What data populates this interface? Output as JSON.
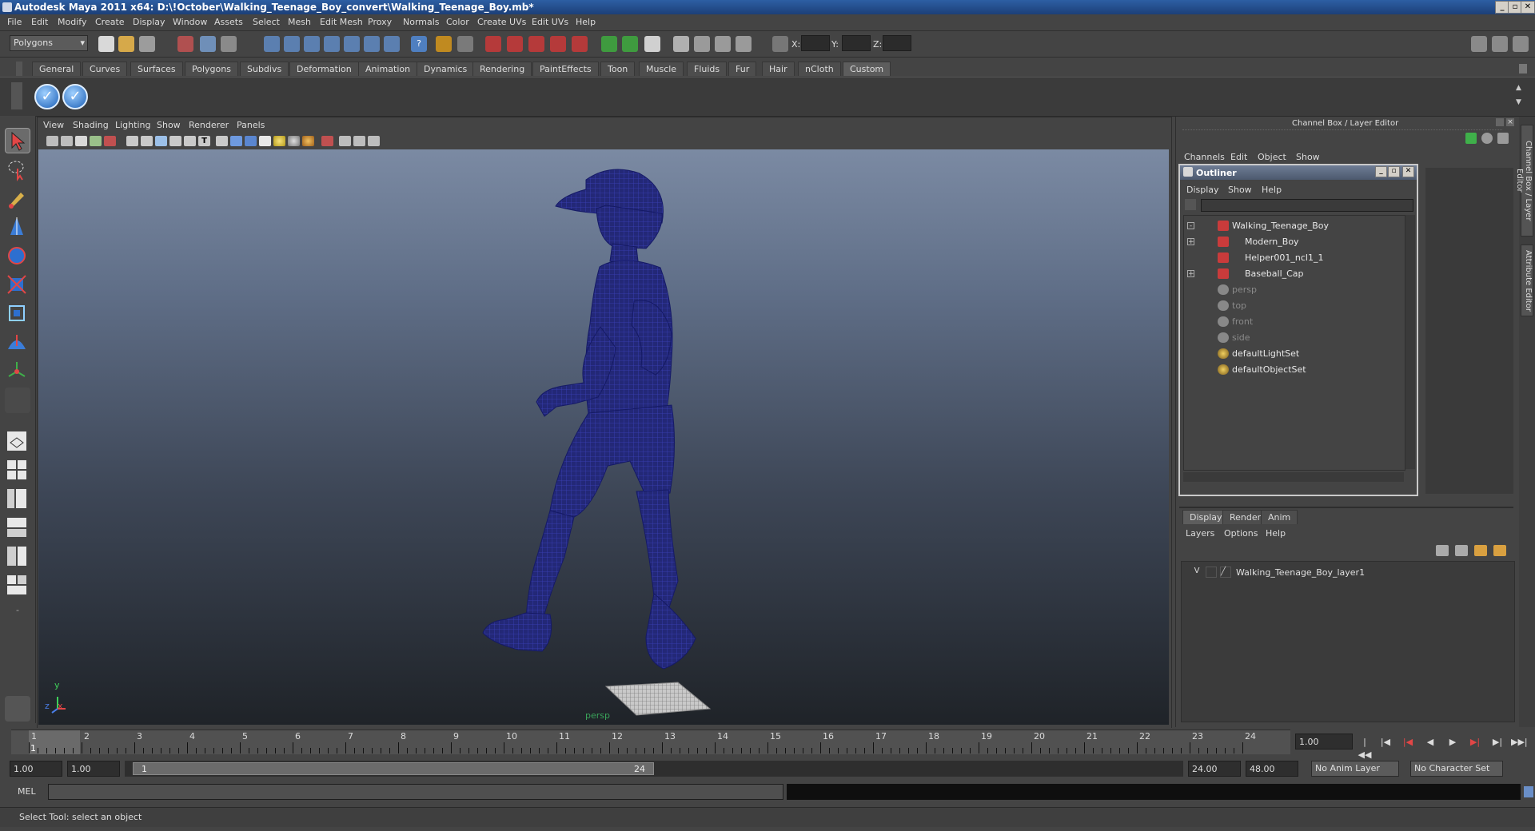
{
  "window": {
    "title": "Autodesk Maya 2011 x64: D:\\!October\\Walking_Teenage_Boy_convert\\Walking_Teenage_Boy.mb*"
  },
  "menubar": [
    "File",
    "Edit",
    "Modify",
    "Create",
    "Display",
    "Window",
    "Assets",
    "Select",
    "Mesh",
    "Edit Mesh",
    "Proxy",
    "Normals",
    "Color",
    "Create UVs",
    "Edit UVs",
    "Help"
  ],
  "statusline": {
    "mode": "Polygons",
    "x_label": "X:",
    "y_label": "Y:",
    "z_label": "Z:"
  },
  "shelf": {
    "tabs": [
      "General",
      "Curves",
      "Surfaces",
      "Polygons",
      "Subdivs",
      "Deformation",
      "Animation",
      "Dynamics",
      "Rendering",
      "PaintEffects",
      "Toon",
      "Muscle",
      "Fluids",
      "Fur",
      "Hair",
      "nCloth",
      "Custom"
    ],
    "active_tab": "Custom"
  },
  "viewport": {
    "menu": [
      "View",
      "Shading",
      "Lighting",
      "Show",
      "Renderer",
      "Panels"
    ],
    "camera_label": "persp",
    "axis_y": "y",
    "axis_x": "x",
    "axis_z": "z",
    "wireframe_color": "#1a1f7a"
  },
  "channelbox": {
    "header": "Channel Box / Layer Editor",
    "menu": [
      "Channels",
      "Edit",
      "Object",
      "Show"
    ]
  },
  "outliner": {
    "title": "Outliner",
    "menu": [
      "Display",
      "Show",
      "Help"
    ],
    "items": [
      {
        "label": "Walking_Teenage_Boy",
        "icon": "transform-icon",
        "expander": "-",
        "dimmed": false
      },
      {
        "label": "Modern_Boy",
        "icon": "transform-icon",
        "expander": "+",
        "dimmed": false
      },
      {
        "label": "Helper001_ncl1_1",
        "icon": "transform-icon",
        "expander": "",
        "dimmed": false
      },
      {
        "label": "Baseball_Cap",
        "icon": "transform-icon",
        "expander": "+",
        "dimmed": false
      },
      {
        "label": "persp",
        "icon": "camera-icon",
        "expander": "",
        "dimmed": true
      },
      {
        "label": "top",
        "icon": "camera-icon",
        "expander": "",
        "dimmed": true
      },
      {
        "label": "front",
        "icon": "camera-icon",
        "expander": "",
        "dimmed": true
      },
      {
        "label": "side",
        "icon": "camera-icon",
        "expander": "",
        "dimmed": true
      },
      {
        "label": "defaultLightSet",
        "icon": "set-icon",
        "expander": "",
        "dimmed": false
      },
      {
        "label": "defaultObjectSet",
        "icon": "set-icon",
        "expander": "",
        "dimmed": false
      }
    ]
  },
  "layers": {
    "tabs": [
      "Display",
      "Render",
      "Anim"
    ],
    "active_tab": "Display",
    "menu": [
      "Layers",
      "Options",
      "Help"
    ],
    "rows": [
      {
        "visible": "V",
        "name": "Walking_Teenage_Boy_layer1"
      }
    ]
  },
  "timeline": {
    "ticks": [
      "1",
      "2",
      "3",
      "4",
      "5",
      "6",
      "7",
      "8",
      "9",
      "10",
      "11",
      "12",
      "13",
      "14",
      "15",
      "16",
      "17",
      "18",
      "19",
      "20",
      "21",
      "22",
      "23",
      "24"
    ],
    "current_frame_marker": "1",
    "current_time": "1.00"
  },
  "range": {
    "start_time": "1.00",
    "playback_start": "1.00",
    "range_start_label": "1",
    "range_end_label": "24",
    "playback_end": "24.00",
    "end_time": "48.00",
    "anim_layer": "No Anim Layer",
    "character_set": "No Character Set"
  },
  "commandline": {
    "language": "MEL"
  },
  "helpline": {
    "text": "Select Tool: select an object"
  }
}
